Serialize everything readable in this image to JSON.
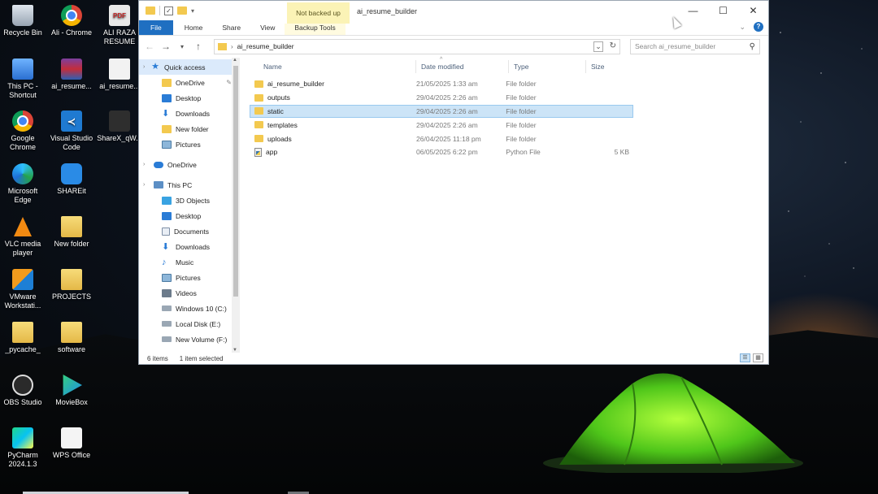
{
  "desktop": {
    "icons": [
      {
        "label": "Recycle Bin",
        "icon": "recycle-bin-icon"
      },
      {
        "label": "Ali - Chrome",
        "icon": "chrome-icon"
      },
      {
        "label": "ALI RAZA RESUME",
        "icon": "pdf-icon"
      },
      {
        "label": "This PC - Shortcut",
        "icon": "this-pc-icon"
      },
      {
        "label": "ai_resume...",
        "icon": "winrar-archive-icon"
      },
      {
        "label": "ai_resume...",
        "icon": "document-icon"
      },
      {
        "label": "Google Chrome",
        "icon": "chrome-icon"
      },
      {
        "label": "Visual Studio Code",
        "icon": "vscode-icon"
      },
      {
        "label": "ShareX_qW...",
        "icon": "sharex-icon"
      },
      {
        "label": "Microsoft Edge",
        "icon": "edge-icon"
      },
      {
        "label": "SHAREit",
        "icon": "shareit-icon"
      },
      {
        "label": "VLC media player",
        "icon": "vlc-icon"
      },
      {
        "label": "New folder",
        "icon": "folder-icon"
      },
      {
        "label": "VMware Workstati...",
        "icon": "vmware-icon"
      },
      {
        "label": "PROJECTS",
        "icon": "folder-icon"
      },
      {
        "label": "_pycache_",
        "icon": "folder-icon"
      },
      {
        "label": "software",
        "icon": "folder-icon"
      },
      {
        "label": "OBS Studio",
        "icon": "obs-icon"
      },
      {
        "label": "MovieBox",
        "icon": "moviebox-icon"
      },
      {
        "label": "PyCharm 2024.1.3",
        "icon": "pycharm-icon"
      },
      {
        "label": "WPS Office",
        "icon": "wps-office-icon"
      }
    ]
  },
  "window": {
    "title": "ai_resume_builder",
    "contextual_tab": "Not backed up",
    "controls": {
      "minimize": "—",
      "maximize": "☐",
      "close": "✕"
    },
    "ribbon_tabs": [
      "File",
      "Home",
      "Share",
      "View",
      "Backup Tools"
    ],
    "help": "?",
    "address": {
      "path": "ai_resume_builder",
      "search_placeholder": "Search ai_resume_builder"
    },
    "nav": [
      {
        "label": "Quick access",
        "icon": "star-icon",
        "kind": "top",
        "selected": true
      },
      {
        "label": "OneDrive",
        "icon": "folder-icon",
        "pinned": true
      },
      {
        "label": "Desktop",
        "icon": "desktop-icon"
      },
      {
        "label": "Downloads",
        "icon": "downloads-icon"
      },
      {
        "label": "New folder",
        "icon": "folder-icon"
      },
      {
        "label": "Pictures",
        "icon": "pictures-icon"
      },
      {
        "label": "OneDrive",
        "icon": "cloud-icon",
        "kind": "top"
      },
      {
        "label": "This PC",
        "icon": "computer-icon",
        "kind": "top"
      },
      {
        "label": "3D Objects",
        "icon": "3d-objects-icon"
      },
      {
        "label": "Desktop",
        "icon": "desktop-icon"
      },
      {
        "label": "Documents",
        "icon": "documents-icon"
      },
      {
        "label": "Downloads",
        "icon": "downloads-icon"
      },
      {
        "label": "Music",
        "icon": "music-icon"
      },
      {
        "label": "Pictures",
        "icon": "pictures-icon"
      },
      {
        "label": "Videos",
        "icon": "videos-icon"
      },
      {
        "label": "Windows 10 (C:)",
        "icon": "drive-icon"
      },
      {
        "label": "Local Disk (E:)",
        "icon": "drive-icon"
      },
      {
        "label": "New Volume (F:)",
        "icon": "drive-icon"
      }
    ],
    "columns": {
      "name": "Name",
      "date": "Date modified",
      "type": "Type",
      "size": "Size"
    },
    "files": [
      {
        "name": "ai_resume_builder",
        "date": "21/05/2025 1:33 am",
        "type": "File folder",
        "size": "",
        "icon": "folder-icon"
      },
      {
        "name": "outputs",
        "date": "29/04/2025 2:26 am",
        "type": "File folder",
        "size": "",
        "icon": "folder-icon"
      },
      {
        "name": "static",
        "date": "29/04/2025 2:26 am",
        "type": "File folder",
        "size": "",
        "icon": "folder-icon",
        "selected": true
      },
      {
        "name": "templates",
        "date": "29/04/2025 2:26 am",
        "type": "File folder",
        "size": "",
        "icon": "folder-icon"
      },
      {
        "name": "uploads",
        "date": "26/04/2025 11:18 pm",
        "type": "File folder",
        "size": "",
        "icon": "folder-icon"
      },
      {
        "name": "app",
        "date": "06/05/2025 6:22 pm",
        "type": "Python File",
        "size": "5 KB",
        "icon": "python-file-icon"
      }
    ],
    "status": {
      "items": "6 items",
      "selected": "1 item selected"
    }
  }
}
